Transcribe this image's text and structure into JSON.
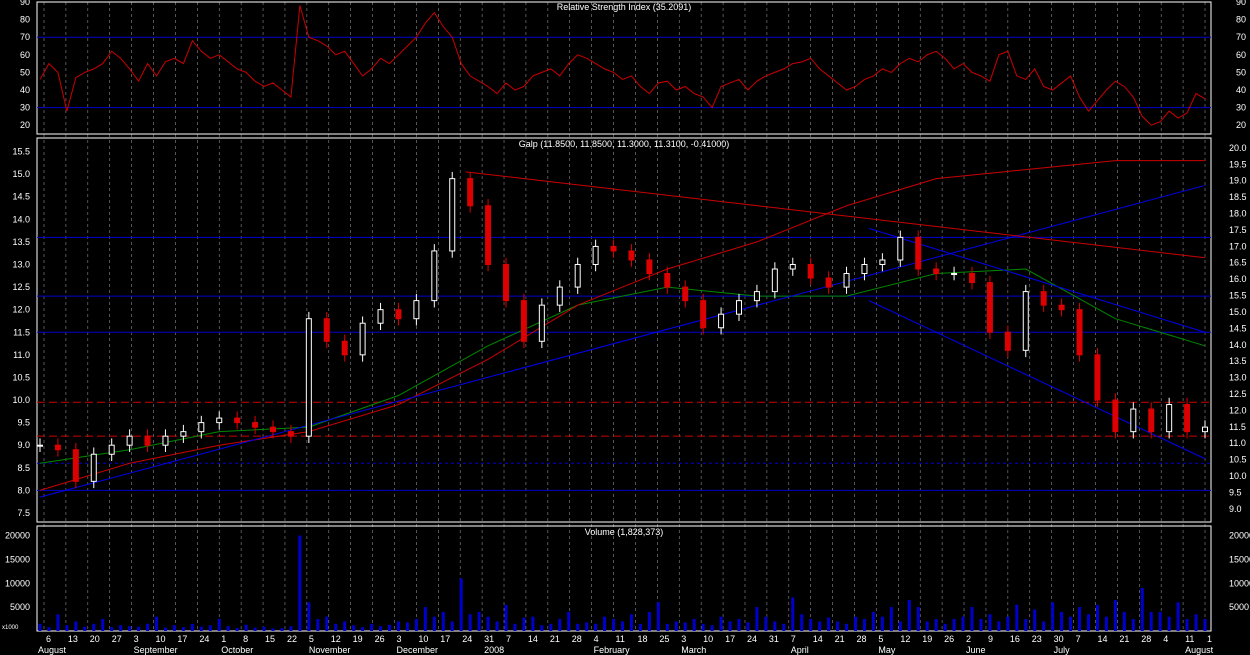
{
  "colors": {
    "background": "#000000",
    "frame": "#ffffff",
    "grid_vertical": "#ffffff",
    "level_line": "#0000cc",
    "rsi_line": "#cc0000",
    "candle_up": "#ffffff",
    "candle_down": "#dd0000",
    "ma_short": "#008800",
    "ma_long": "#cc0000",
    "trendline_blue": "#0000ee",
    "trendline_red": "#cc0000",
    "support_dashed": "#cc0000",
    "volume_bar": "#0000cc",
    "text": "#ffffff"
  },
  "chart_data": [
    {
      "panel": "rsi",
      "type": "line",
      "title": "Relative Strength Index (35.2091)",
      "ylim": [
        15,
        90
      ],
      "yticks": [
        20,
        30,
        40,
        50,
        60,
        70,
        80,
        90
      ],
      "reference_levels": [
        70,
        30
      ],
      "x": [
        0,
        2,
        4,
        6,
        8,
        10,
        12,
        14,
        16,
        18,
        20,
        22,
        24,
        26,
        28,
        30,
        32,
        34,
        36,
        38,
        40,
        42,
        44,
        46,
        48,
        50,
        52,
        54,
        56,
        58,
        60,
        62,
        64,
        66,
        68,
        70,
        72,
        74,
        76,
        78,
        80,
        82,
        84,
        86,
        88,
        90,
        92,
        94,
        96,
        98,
        100,
        102,
        104,
        106,
        108,
        110,
        112,
        114,
        116,
        118,
        120,
        122,
        124,
        126,
        128,
        130,
        132,
        134,
        136,
        138,
        140,
        142,
        144,
        146,
        148,
        150,
        152,
        154,
        156,
        158,
        160,
        162,
        164,
        166,
        168,
        170,
        172,
        174,
        176,
        178,
        180,
        182,
        184,
        186,
        188,
        190,
        192,
        194,
        196,
        198,
        200,
        202,
        204,
        206,
        208,
        210,
        212,
        214,
        216,
        218,
        220,
        222,
        224,
        226,
        228,
        230,
        232,
        234,
        236,
        238,
        240,
        242,
        244,
        246,
        248,
        250,
        252,
        254,
        256,
        258,
        260
      ],
      "values": [
        46,
        55,
        50,
        28,
        47,
        50,
        52,
        55,
        62,
        58,
        52,
        45,
        55,
        48,
        56,
        58,
        55,
        68,
        62,
        58,
        60,
        56,
        52,
        50,
        45,
        42,
        44,
        40,
        36,
        88,
        70,
        68,
        65,
        60,
        62,
        55,
        48,
        52,
        58,
        55,
        60,
        65,
        70,
        78,
        84,
        76,
        70,
        55,
        48,
        45,
        42,
        38,
        44,
        40,
        42,
        48,
        50,
        52,
        48,
        55,
        60,
        58,
        55,
        52,
        50,
        46,
        48,
        42,
        38,
        44,
        45,
        40,
        42,
        38,
        36,
        30,
        42,
        44,
        46,
        40,
        45,
        48,
        50,
        52,
        55,
        56,
        58,
        52,
        48,
        44,
        40,
        42,
        46,
        48,
        52,
        50,
        55,
        58,
        56,
        60,
        62,
        58,
        52,
        55,
        50,
        48,
        45,
        60,
        62,
        48,
        46,
        52,
        42,
        40,
        44,
        48,
        36,
        28,
        34,
        40,
        45,
        42,
        36,
        25,
        20,
        22,
        28,
        24,
        27,
        38,
        35
      ],
      "data_labels": []
    },
    {
      "panel": "price",
      "type": "candlestick",
      "title": "Galp (11.8500, 11.8500, 11.3000, 11.3100, -0.41000)",
      "ylim": [
        7.3,
        15.8
      ],
      "yticks": [
        7.5,
        8.0,
        8.5,
        9.0,
        9.5,
        10.0,
        10.5,
        11.0,
        11.5,
        12.0,
        12.5,
        13.0,
        13.5,
        14.0,
        14.5,
        15.0,
        15.5
      ],
      "yticks_right": [
        9.0,
        9.5,
        10.0,
        10.5,
        11.0,
        11.5,
        12.0,
        12.5,
        13.0,
        13.5,
        14.0,
        14.5,
        15.0,
        15.5,
        16.0,
        16.5,
        17.0,
        17.5,
        18.0,
        18.5,
        19.0,
        19.5,
        20.0
      ],
      "reference_levels": [
        13.6,
        12.3,
        11.5,
        9.95,
        9.2,
        8.6,
        8.0
      ],
      "x": [
        0,
        4,
        8,
        12,
        16,
        20,
        24,
        28,
        32,
        36,
        40,
        44,
        48,
        52,
        56,
        60,
        64,
        68,
        72,
        76,
        80,
        84,
        88,
        92,
        96,
        100,
        104,
        108,
        112,
        116,
        120,
        124,
        128,
        132,
        136,
        140,
        144,
        148,
        152,
        156,
        160,
        164,
        168,
        172,
        176,
        180,
        184,
        188,
        192,
        196,
        200,
        204,
        208,
        212,
        216,
        220,
        224,
        228,
        232,
        236,
        240,
        244,
        248,
        252,
        256,
        260
      ],
      "close": [
        9.0,
        8.9,
        8.2,
        8.8,
        9.0,
        9.2,
        9.0,
        9.2,
        9.3,
        9.5,
        9.6,
        9.5,
        9.4,
        9.3,
        9.2,
        11.8,
        11.3,
        11.0,
        11.7,
        12.0,
        11.8,
        12.2,
        13.3,
        14.9,
        14.3,
        13.0,
        12.2,
        11.3,
        12.1,
        12.5,
        13.0,
        13.4,
        13.3,
        13.1,
        12.8,
        12.5,
        12.2,
        11.6,
        11.9,
        12.2,
        12.4,
        12.9,
        13.0,
        12.7,
        12.5,
        12.8,
        13.0,
        13.1,
        13.6,
        12.9,
        12.8,
        12.8,
        12.6,
        11.5,
        11.1,
        12.4,
        12.1,
        12.0,
        11.0,
        10.0,
        9.3,
        9.8,
        9.3,
        9.9,
        9.3,
        9.4
      ],
      "moving_averages": [
        {
          "x": [
            0,
            20,
            40,
            60,
            80,
            100,
            120,
            140,
            160,
            180,
            200,
            220,
            240,
            260
          ],
          "values": [
            8.6,
            8.9,
            9.3,
            9.4,
            10.1,
            11.2,
            12.1,
            12.5,
            12.3,
            12.3,
            12.8,
            12.9,
            11.8,
            11.2
          ]
        },
        {
          "x": [
            0,
            20,
            40,
            60,
            80,
            100,
            120,
            140,
            160,
            180,
            200,
            220,
            240,
            260
          ],
          "values": [
            8.0,
            8.6,
            9.0,
            9.3,
            9.9,
            10.9,
            12.1,
            12.9,
            13.5,
            14.3,
            14.9,
            15.1,
            15.3,
            15.3
          ]
        }
      ],
      "trendlines": [
        {
          "x": [
            0,
            260
          ],
          "values": [
            7.85,
            14.75
          ]
        },
        {
          "x": [
            95,
            260
          ],
          "values": [
            15.05,
            13.15
          ]
        },
        {
          "x": [
            185,
            260
          ],
          "values": [
            13.8,
            11.5
          ]
        },
        {
          "x": [
            185,
            260
          ],
          "values": [
            12.2,
            8.7
          ]
        }
      ],
      "data_labels": []
    },
    {
      "panel": "volume",
      "type": "bar",
      "title": "Volume (1,828,373)",
      "ylim": [
        0,
        22000
      ],
      "yticks": [
        5000,
        10000,
        15000,
        20000
      ],
      "axis_unit_label": "x1000",
      "x": [
        0,
        2,
        4,
        6,
        8,
        10,
        12,
        14,
        16,
        18,
        20,
        22,
        24,
        26,
        28,
        30,
        32,
        34,
        36,
        38,
        40,
        42,
        44,
        46,
        48,
        50,
        52,
        54,
        56,
        58,
        60,
        62,
        64,
        66,
        68,
        70,
        72,
        74,
        76,
        78,
        80,
        82,
        84,
        86,
        88,
        90,
        92,
        94,
        96,
        98,
        100,
        102,
        104,
        106,
        108,
        110,
        112,
        114,
        116,
        118,
        120,
        122,
        124,
        126,
        128,
        130,
        132,
        134,
        136,
        138,
        140,
        142,
        144,
        146,
        148,
        150,
        152,
        154,
        156,
        158,
        160,
        162,
        164,
        166,
        168,
        170,
        172,
        174,
        176,
        178,
        180,
        182,
        184,
        186,
        188,
        190,
        192,
        194,
        196,
        198,
        200,
        202,
        204,
        206,
        208,
        210,
        212,
        214,
        216,
        218,
        220,
        222,
        224,
        226,
        228,
        230,
        232,
        234,
        236,
        238,
        240,
        242,
        244,
        246,
        248,
        250,
        252,
        254,
        256,
        258,
        260
      ],
      "values": [
        1500,
        800,
        3500,
        1200,
        2000,
        900,
        1500,
        2500,
        800,
        1200,
        1000,
        900,
        1500,
        3000,
        700,
        1200,
        800,
        1500,
        900,
        1200,
        2500,
        1000,
        600,
        1300,
        700,
        900,
        500,
        600,
        1000,
        20000,
        6000,
        2500,
        3000,
        1500,
        2000,
        1200,
        800,
        1500,
        1000,
        1300,
        2000,
        1800,
        2500,
        5000,
        3000,
        4000,
        2000,
        11000,
        3500,
        4000,
        3000,
        2000,
        5500,
        1500,
        2800,
        3000,
        1200,
        1500,
        2500,
        4000,
        1500,
        1800,
        1500,
        3000,
        2500,
        2000,
        3500,
        1500,
        4000,
        6000,
        1500,
        2000,
        1800,
        2500,
        1500,
        1200,
        3000,
        2000,
        2500,
        1800,
        5000,
        3000,
        2000,
        1500,
        7000,
        3500,
        2500,
        2000,
        2800,
        2000,
        1500,
        3000,
        2500,
        4000,
        3000,
        5000,
        2000,
        6500,
        5000,
        2000,
        2500,
        1500,
        2500,
        3000,
        5000,
        2500,
        3500,
        2000,
        3000,
        5500,
        2500,
        4500,
        2000,
        6000,
        4000,
        3000,
        5000,
        3500,
        5500,
        3000,
        6500,
        4000,
        2500,
        9000,
        4000,
        4000,
        3000,
        6000,
        2500,
        3500,
        2500
      ],
      "data_labels": []
    }
  ],
  "x_axis": {
    "day_labels": [
      "6",
      "13",
      "20",
      "27",
      "3",
      "10",
      "17",
      "24",
      "1",
      "8",
      "15",
      "22",
      "5",
      "12",
      "19",
      "26",
      "3",
      "10",
      "17",
      "24",
      "31",
      "7",
      "14",
      "21",
      "28",
      "4",
      "11",
      "18",
      "25",
      "3",
      "10",
      "17",
      "24",
      "31",
      "7",
      "14",
      "21",
      "28",
      "5",
      "12",
      "19",
      "26",
      "2",
      "9",
      "16",
      "23",
      "30",
      "7",
      "14",
      "21",
      "28",
      "4",
      "11",
      "1"
    ],
    "month_labels": [
      "August",
      "September",
      "October",
      "November",
      "December",
      "2008",
      "February",
      "March",
      "April",
      "May",
      "June",
      "July",
      "August"
    ]
  }
}
